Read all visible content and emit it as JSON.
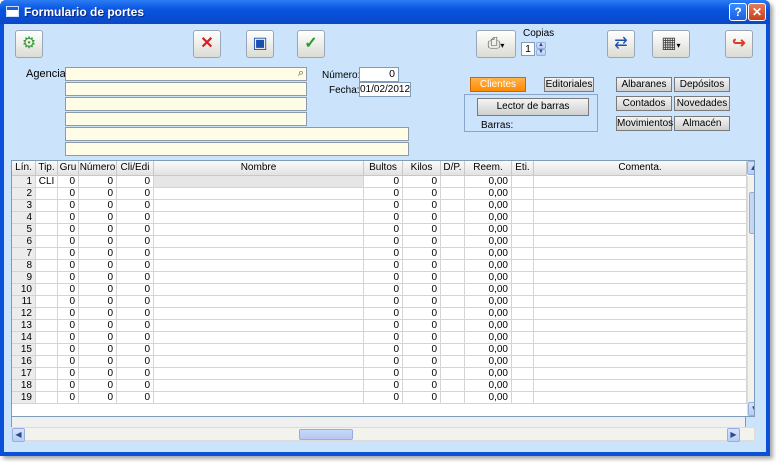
{
  "window": {
    "title": "Formulario de portes",
    "help_label": "?",
    "close_label": "✕"
  },
  "toolbar": {
    "copies_label": "Copias",
    "copies_value": "1"
  },
  "form": {
    "agency_label": "Agencia:",
    "number_label": "Número:",
    "number_value": "0",
    "date_label": "Fecha:",
    "date_value": "01/02/2012"
  },
  "buttons": {
    "clientes": "Clientes",
    "editoriales": "Editoriales",
    "lector": "Lector de barras",
    "barras_label": "Barras:",
    "albaranes": "Albaranes",
    "depositos": "Depósitos",
    "contados": "Contados",
    "novedades": "Novedades",
    "movimientos": "Movimientos",
    "almacen": "Almacén"
  },
  "table": {
    "headers": [
      "Lín.",
      "Tip.",
      "Gru",
      "Número",
      "Cli/Edi",
      "Nombre",
      "Bultos",
      "Kilos",
      "D/P.",
      "Reem.",
      "Eti.",
      "Comenta."
    ],
    "rows": [
      [
        "1",
        "CLI",
        "0",
        "0",
        "0",
        "",
        "0",
        "0",
        "",
        "0,00",
        "",
        ""
      ],
      [
        "2",
        "",
        "0",
        "0",
        "0",
        "",
        "0",
        "0",
        "",
        "0,00",
        "",
        ""
      ],
      [
        "3",
        "",
        "0",
        "0",
        "0",
        "",
        "0",
        "0",
        "",
        "0,00",
        "",
        ""
      ],
      [
        "4",
        "",
        "0",
        "0",
        "0",
        "",
        "0",
        "0",
        "",
        "0,00",
        "",
        ""
      ],
      [
        "5",
        "",
        "0",
        "0",
        "0",
        "",
        "0",
        "0",
        "",
        "0,00",
        "",
        ""
      ],
      [
        "6",
        "",
        "0",
        "0",
        "0",
        "",
        "0",
        "0",
        "",
        "0,00",
        "",
        ""
      ],
      [
        "7",
        "",
        "0",
        "0",
        "0",
        "",
        "0",
        "0",
        "",
        "0,00",
        "",
        ""
      ],
      [
        "8",
        "",
        "0",
        "0",
        "0",
        "",
        "0",
        "0",
        "",
        "0,00",
        "",
        ""
      ],
      [
        "9",
        "",
        "0",
        "0",
        "0",
        "",
        "0",
        "0",
        "",
        "0,00",
        "",
        ""
      ],
      [
        "10",
        "",
        "0",
        "0",
        "0",
        "",
        "0",
        "0",
        "",
        "0,00",
        "",
        ""
      ],
      [
        "11",
        "",
        "0",
        "0",
        "0",
        "",
        "0",
        "0",
        "",
        "0,00",
        "",
        ""
      ],
      [
        "12",
        "",
        "0",
        "0",
        "0",
        "",
        "0",
        "0",
        "",
        "0,00",
        "",
        ""
      ],
      [
        "13",
        "",
        "0",
        "0",
        "0",
        "",
        "0",
        "0",
        "",
        "0,00",
        "",
        ""
      ],
      [
        "14",
        "",
        "0",
        "0",
        "0",
        "",
        "0",
        "0",
        "",
        "0,00",
        "",
        ""
      ],
      [
        "15",
        "",
        "0",
        "0",
        "0",
        "",
        "0",
        "0",
        "",
        "0,00",
        "",
        ""
      ],
      [
        "16",
        "",
        "0",
        "0",
        "0",
        "",
        "0",
        "0",
        "",
        "0,00",
        "",
        ""
      ],
      [
        "17",
        "",
        "0",
        "0",
        "0",
        "",
        "0",
        "0",
        "",
        "0,00",
        "",
        ""
      ],
      [
        "18",
        "",
        "0",
        "0",
        "0",
        "",
        "0",
        "0",
        "",
        "0,00",
        "",
        ""
      ],
      [
        "19",
        "",
        "0",
        "0",
        "0",
        "",
        "0",
        "0",
        "",
        "0,00",
        "",
        ""
      ]
    ]
  }
}
